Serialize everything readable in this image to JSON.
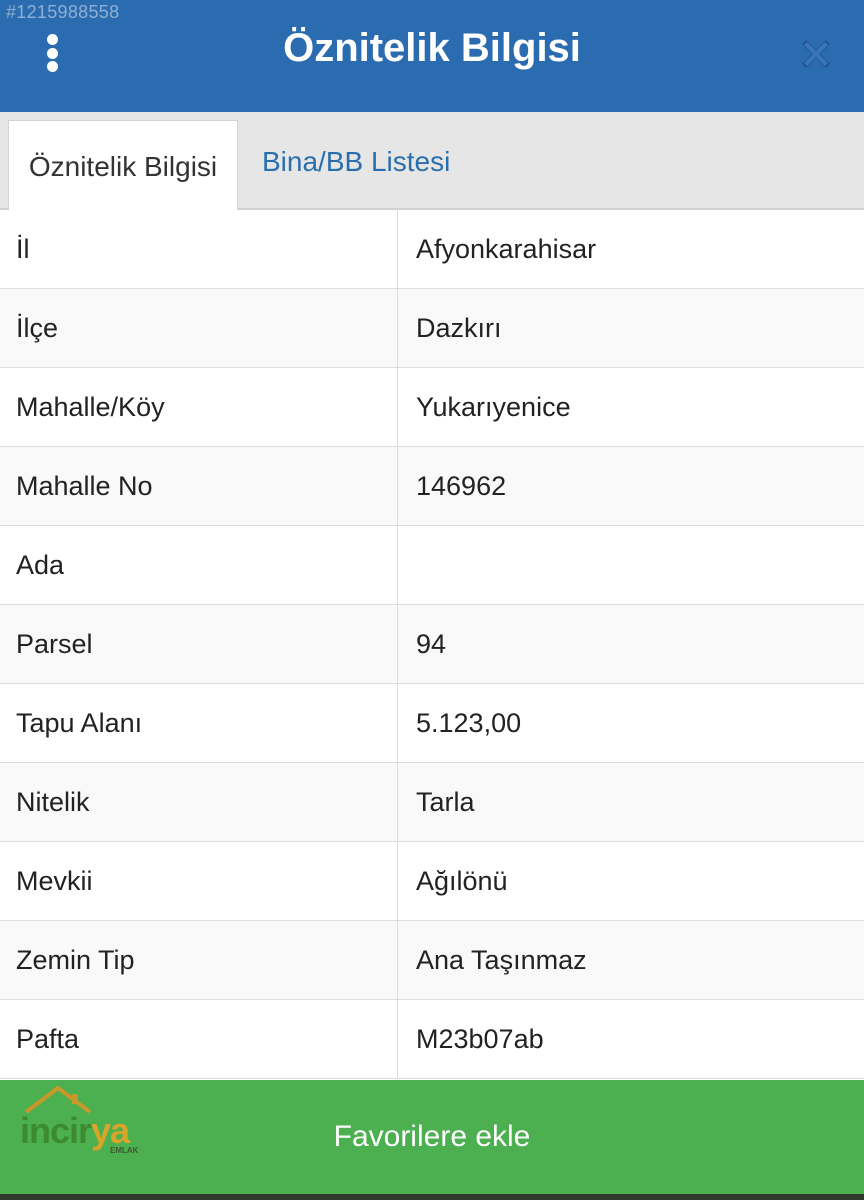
{
  "watermark_id": "#1215988558",
  "header": {
    "title": "Öznitelik Bilgisi",
    "menu_icon": "more-vertical-icon",
    "close_icon": "close-icon"
  },
  "tabs": [
    {
      "label": "Öznitelik Bilgisi",
      "active": true
    },
    {
      "label": "Bina/BB Listesi",
      "active": false
    }
  ],
  "attributes": [
    {
      "key": "İl",
      "value": "Afyonkarahisar"
    },
    {
      "key": "İlçe",
      "value": "Dazkırı"
    },
    {
      "key": "Mahalle/Köy",
      "value": "Yukarıyenice"
    },
    {
      "key": "Mahalle No",
      "value": "146962"
    },
    {
      "key": "Ada",
      "value": ""
    },
    {
      "key": "Parsel",
      "value": "94"
    },
    {
      "key": "Tapu Alanı",
      "value": "5.123,00"
    },
    {
      "key": "Nitelik",
      "value": "Tarla"
    },
    {
      "key": "Mevkii",
      "value": "Ağılönü"
    },
    {
      "key": "Zemin Tip",
      "value": "Ana Taşınmaz"
    },
    {
      "key": "Pafta",
      "value": "M23b07ab"
    }
  ],
  "footer": {
    "add_favorites_label": "Favorilere ekle"
  },
  "logo": {
    "text_main": "incir",
    "text_accent": "ya",
    "subtext": "EMLAK"
  },
  "colors": {
    "header_bg": "#2b6cb0",
    "tab_link": "#2a6fad",
    "footer_bg": "#4caf50"
  }
}
